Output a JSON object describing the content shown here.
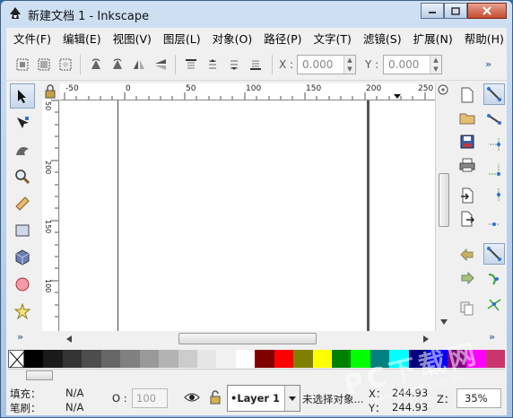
{
  "window": {
    "title": "新建文档 1 - Inkscape",
    "buttons": [
      "minimize",
      "maximize",
      "close"
    ]
  },
  "menu": [
    "文件(F)",
    "编辑(E)",
    "视图(V)",
    "图层(L)",
    "对象(O)",
    "路径(P)",
    "文字(T)",
    "滤镜(S)",
    "扩展(N)",
    "帮助(H)"
  ],
  "toolbar": {
    "x_label": "X :",
    "x_value": "0.000",
    "y_label": "Y :",
    "y_value": "0.000",
    "more": "»"
  },
  "tools": [
    "selector-icon",
    "node-editor-icon",
    "tweak-icon",
    "zoom-icon",
    "measure-icon",
    "rectangle-icon",
    "box-3d-icon",
    "ellipse-icon",
    "star-icon"
  ],
  "tools_more": "»",
  "ruler": {
    "h_ticks": [
      "-50",
      "0",
      "50",
      "100",
      "150",
      "200",
      "250"
    ],
    "v_ticks": [
      "50",
      "200",
      "150",
      "100"
    ]
  },
  "palette": {
    "colors": [
      "#000000",
      "#1a1a1a",
      "#333333",
      "#4d4d4d",
      "#666666",
      "#808080",
      "#999999",
      "#b3b3b3",
      "#cccccc",
      "#e6e6e6",
      "#f2f2f2",
      "#ffffff",
      "#800000",
      "#ff0000",
      "#808000",
      "#ffff00",
      "#008000",
      "#00ff00",
      "#008080",
      "#00ffff",
      "#000080",
      "#0000ff",
      "#800080",
      "#ff00ff",
      "#c8366b"
    ]
  },
  "status": {
    "fill_label": "填充：",
    "fill_value": "N/A",
    "stroke_label": "笔刷：",
    "stroke_value": "N/A",
    "opacity_label": "O :",
    "opacity_value": "100",
    "layer": "•Layer 1",
    "message": "未选择对象...",
    "x_label": "X：",
    "x_value": "244.93",
    "y_label": "Y：",
    "y_value": "244.93",
    "z_label": "Z：",
    "zoom": "35%"
  },
  "watermark": {
    "text": "PC下载网",
    "url": "www.pcsoft.com.cn"
  }
}
